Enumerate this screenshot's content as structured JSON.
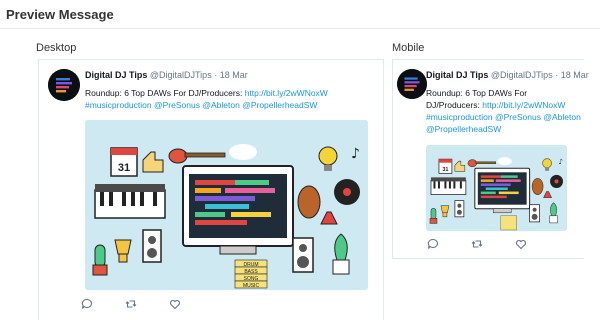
{
  "header": {
    "title": "Preview Message"
  },
  "sections": {
    "desktop_label": "Desktop",
    "mobile_label": "Mobile"
  },
  "tweet": {
    "name": "Digital DJ Tips",
    "handle": "@DigitalDJTips",
    "separator": "·",
    "date": "18 Mar",
    "text": "Roundup: 6 Top DAWs For DJ/Producers:",
    "url": "http://bit.ly/2wWNoxW",
    "hashtag": "#musicproduction",
    "mention_presonus": "@PreSonus",
    "mention_ableton": "@Ableton",
    "mention_propellerhead": "@PropellerheadSW"
  },
  "media": {
    "calendar_day": "31",
    "stickers": [
      "DRUM",
      "BASS",
      "SONG",
      "MUSIC"
    ],
    "alt": "DAW illustration"
  },
  "icons": [
    "avatar-logo-icon",
    "reply-icon",
    "retweet-icon",
    "like-icon"
  ],
  "colors": {
    "link": "#1b95e0",
    "media_bg": "#cfe9f3",
    "border": "#e1e8ed",
    "meta": "#657786"
  }
}
